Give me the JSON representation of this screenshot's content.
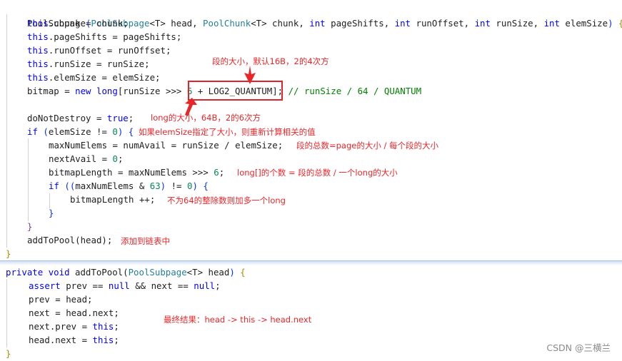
{
  "code_block_1": {
    "lines": [
      [
        "PoolSubpage",
        "(",
        "PoolSubpage",
        "<T>",
        " head, ",
        "PoolChunk",
        "<T>",
        " chunk, ",
        "int",
        " pageShifts, ",
        "int",
        " runOffset, ",
        "int",
        " runSize, ",
        "int",
        " elemSize",
        ")",
        " {"
      ],
      [
        "this",
        ".chunk = chunk;"
      ],
      [
        "this",
        ".pageShifts = pageShifts;"
      ],
      [
        "this",
        ".runOffset = runOffset;"
      ],
      [
        "this",
        ".runSize = runSize;"
      ],
      [
        "this",
        ".elemSize = elemSize;"
      ],
      [
        "bitmap = ",
        "new",
        " ",
        "long",
        "[runSize >>> ",
        "6",
        " + LOG2_QUANTUM",
        "]; ",
        "// runSize / 64 / QUANTUM"
      ],
      [
        ""
      ],
      [
        "doNotDestroy = ",
        "true",
        ";"
      ],
      [
        "if",
        " ",
        "(",
        "elemSize != ",
        "0",
        ")",
        " {"
      ],
      [
        "maxNumElems = numAvail = runSize / elemSize;"
      ],
      [
        "nextAvail = ",
        "0",
        ";"
      ],
      [
        "bitmapLength = maxNumElems >>> ",
        "6",
        ";"
      ],
      [
        "if",
        " ",
        "((",
        "maxNumElems & ",
        "63",
        ")",
        " != ",
        "0",
        ")",
        " {"
      ],
      [
        "bitmapLength ++;"
      ],
      [
        "}"
      ],
      [
        "}"
      ],
      [
        "addToPool(head);"
      ],
      [
        "}"
      ]
    ]
  },
  "code_block_2": {
    "lines": [
      [
        "private",
        " ",
        "void",
        " addToPool(",
        "PoolSubpage",
        "<T>",
        " head",
        ")",
        " {"
      ],
      [
        "assert",
        " prev == ",
        "null",
        " && next == ",
        "null",
        ";"
      ],
      [
        "prev = head;"
      ],
      [
        "next = head.next;"
      ],
      [
        "next.prev = ",
        "this",
        ";"
      ],
      [
        "head.next = ",
        "this",
        ";"
      ],
      [
        "}"
      ]
    ]
  },
  "annotations": {
    "quantum_note": "段的大小，默认16B，2的4次方",
    "long_size_note": "long的大小，64B，2的6次方",
    "elemsize_note": "如果elemSize指定了大小，则重新计算相关的值",
    "max_elems_note": "段的总数=page的大小 / 每个段的大小",
    "bitmap_len_note": "long[]的个数 = 段的总数 / 一个long的大小",
    "remainder_note": "不为64的整除数则加多一个long",
    "add_to_pool_note": "添加到链表中",
    "final_result_note": "最终结果：head -> this -> head.next"
  },
  "watermark": "CSDN @三横兰",
  "colors": {
    "annotation_red": "#e8262a",
    "keyword_blue": "#0000ff",
    "type_teal": "#267f99",
    "number_green": "#098658",
    "comment_green": "#008000"
  }
}
